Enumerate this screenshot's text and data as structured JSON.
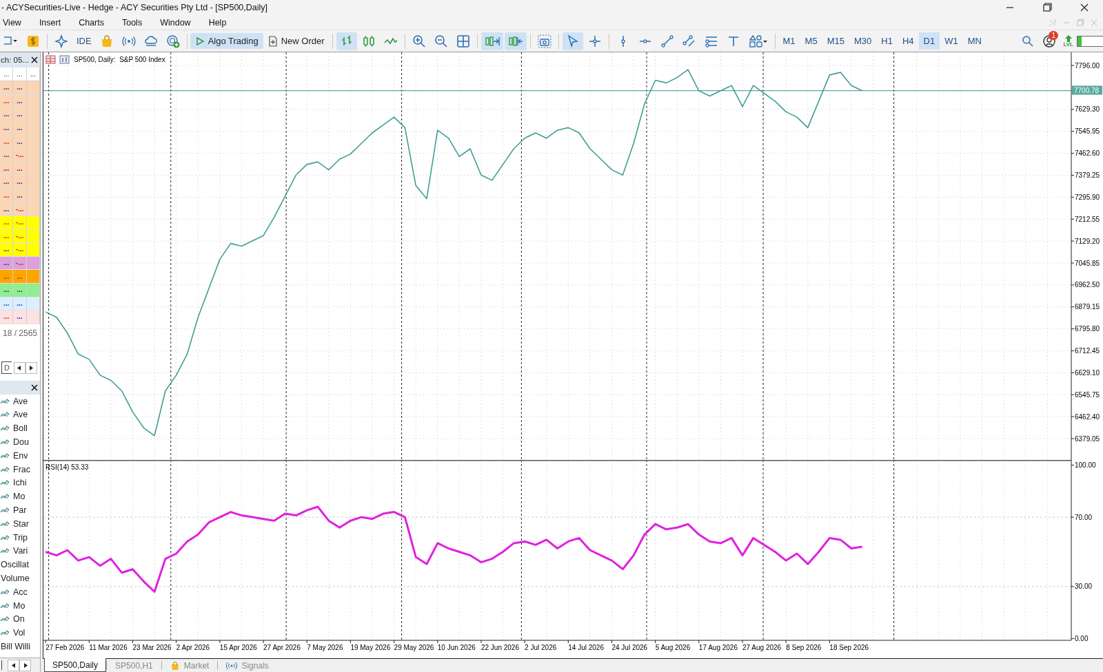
{
  "window": {
    "title": "- ACYSecurities-Live - Hedge - ACY Securities Pty Ltd - [SP500,Daily]"
  },
  "menu": [
    "View",
    "Insert",
    "Charts",
    "Tools",
    "Window",
    "Help"
  ],
  "toolbar": {
    "ide_label": "IDE",
    "algo_trading": {
      "label": "Algo Trading",
      "on": true
    },
    "new_order": "New Order",
    "chart_types": [
      {
        "selected": true
      },
      {
        "selected": false
      },
      {
        "selected": false
      }
    ],
    "auto_scroll": {
      "on": true
    },
    "chart_shift": {
      "on": true
    },
    "cursor_tools": [
      {
        "selected": true
      },
      {
        "selected": false
      }
    ],
    "timeframes": [
      {
        "label": "M1",
        "selected": false
      },
      {
        "label": "M5",
        "selected": false
      },
      {
        "label": "M15",
        "selected": false
      },
      {
        "label": "M30",
        "selected": false
      },
      {
        "label": "H1",
        "selected": false
      },
      {
        "label": "H4",
        "selected": false
      },
      {
        "label": "D1",
        "selected": true
      },
      {
        "label": "W1",
        "selected": false
      },
      {
        "label": "MN",
        "selected": false
      }
    ],
    "notifications": "1",
    "level_badge": "LVL",
    "meter": {
      "level": 0.15
    }
  },
  "market_watch": {
    "title": "ch: 05...",
    "columns": [
      "...",
      "...",
      "..."
    ],
    "rows": [
      {
        "color": "#fcd5b4",
        "bid": "...",
        "change": "...",
        "bid_down": false,
        "change_down": false
      },
      {
        "color": "#fcd5b4",
        "bid": "...",
        "change": "...",
        "bid_down": true,
        "change_down": false
      },
      {
        "color": "#fcd5b4",
        "bid": "...",
        "change": "...",
        "bid_down": false,
        "change_down": false
      },
      {
        "color": "#fcd5b4",
        "bid": "...",
        "change": "...",
        "bid_down": false,
        "change_down": false
      },
      {
        "color": "#fcd5b4",
        "bid": "...",
        "change": "...",
        "bid_down": true,
        "change_down": false
      },
      {
        "color": "#fcd5b4",
        "bid": "...",
        "change": "-...",
        "bid_down": false,
        "change_down": true
      },
      {
        "color": "#fcd5b4",
        "bid": "...",
        "change": "...",
        "bid_down": false,
        "change_down": false
      },
      {
        "color": "#fcd5b4",
        "bid": "...",
        "change": "...",
        "bid_down": false,
        "change_down": false
      },
      {
        "color": "#fcd5b4",
        "bid": "...",
        "change": "...",
        "bid_down": true,
        "change_down": false
      },
      {
        "color": "#fcd5b4",
        "bid": "...",
        "change": "-...",
        "bid_down": false,
        "change_down": true
      },
      {
        "color": "#ffff00",
        "bid": "...",
        "change": "-...",
        "bid_down": true,
        "change_down": true
      },
      {
        "color": "#ffff00",
        "bid": "...",
        "change": "-...",
        "bid_down": true,
        "change_down": true
      },
      {
        "color": "#ffff00",
        "bid": "...",
        "change": "-...",
        "bid_down": false,
        "change_down": true
      },
      {
        "color": "#dda0dd",
        "bid": "...",
        "change": "-...",
        "bid_down": false,
        "change_down": true
      },
      {
        "color": "#ffa500",
        "bid": "...",
        "change": "...",
        "bid_down": true,
        "change_down": true
      },
      {
        "color": "#90ee90",
        "bid": "...",
        "change": "...",
        "bid_down": false,
        "change_down": false
      },
      {
        "color": "#ddeeff",
        "bid": "...",
        "change": "...",
        "bid_down": false,
        "change_down": false
      },
      {
        "color": "#fde2e2",
        "bid": "...",
        "change": "...",
        "bid_down": true,
        "change_down": false
      }
    ],
    "count": "18 / 2565",
    "tab": "D"
  },
  "navigator": {
    "items": [
      {
        "label": "Ave",
        "kind": "indicator"
      },
      {
        "label": "Ave",
        "kind": "indicator"
      },
      {
        "label": "Boll",
        "kind": "indicator"
      },
      {
        "label": "Dou",
        "kind": "indicator"
      },
      {
        "label": "Env",
        "kind": "indicator"
      },
      {
        "label": "Frac",
        "kind": "indicator"
      },
      {
        "label": "Ichi",
        "kind": "indicator"
      },
      {
        "label": "Mo",
        "kind": "indicator"
      },
      {
        "label": "Par",
        "kind": "indicator"
      },
      {
        "label": "Star",
        "kind": "indicator"
      },
      {
        "label": "Trip",
        "kind": "indicator"
      },
      {
        "label": "Vari",
        "kind": "indicator"
      },
      {
        "label": "Oscillat",
        "kind": "folder"
      },
      {
        "label": "Volume",
        "kind": "folder"
      },
      {
        "label": "Acc",
        "kind": "indicator"
      },
      {
        "label": "Mo",
        "kind": "indicator"
      },
      {
        "label": "On",
        "kind": "indicator"
      },
      {
        "label": "Vol",
        "kind": "indicator"
      },
      {
        "label": "Bill Willi",
        "kind": "folder"
      }
    ]
  },
  "chart": {
    "header": "SP500, Daily:  S&P 500 Index",
    "chart_data": {
      "type": "line",
      "ylim": [
        6298,
        7846
      ],
      "grid": true,
      "ref_lines": [
        {
          "axis": "y",
          "value": 7700.78,
          "label": "7700.78",
          "color": "#5aa9a0"
        }
      ],
      "yticks": [
        {
          "value": 7796,
          "label": "7796.00"
        },
        {
          "value": 7629.3,
          "label": "7629.30"
        },
        {
          "value": 7545.95,
          "label": "7545.95"
        },
        {
          "value": 7462.6,
          "label": "7462.60"
        },
        {
          "value": 7379.25,
          "label": "7379.25"
        },
        {
          "value": 7295.9,
          "label": "7295.90"
        },
        {
          "value": 7212.55,
          "label": "7212.55"
        },
        {
          "value": 7129.2,
          "label": "7129.20"
        },
        {
          "value": 7045.85,
          "label": "7045.85"
        },
        {
          "value": 6962.5,
          "label": "6962.50"
        },
        {
          "value": 6879.15,
          "label": "6879.15"
        },
        {
          "value": 6795.8,
          "label": "6795.80"
        },
        {
          "value": 6712.45,
          "label": "6712.45"
        },
        {
          "value": 6629.1,
          "label": "6629.10"
        },
        {
          "value": 6545.75,
          "label": "6545.75"
        },
        {
          "value": 6462.4,
          "label": "6462.40"
        },
        {
          "value": 6379.05,
          "label": "6379.05"
        }
      ],
      "series": [
        {
          "color": "#3f9e93",
          "values": [
            6860,
            6840,
            6780,
            6700,
            6680,
            6620,
            6600,
            6560,
            6480,
            6420,
            6390,
            6560,
            6620,
            6700,
            6840,
            6950,
            7060,
            7120,
            7110,
            7130,
            7150,
            7220,
            7300,
            7380,
            7420,
            7430,
            7400,
            7440,
            7460,
            7500,
            7540,
            7570,
            7600,
            7560,
            7340,
            7290,
            7550,
            7520,
            7450,
            7480,
            7380,
            7360,
            7420,
            7480,
            7520,
            7540,
            7520,
            7550,
            7560,
            7540,
            7480,
            7440,
            7400,
            7380,
            7500,
            7650,
            7740,
            7730,
            7750,
            7780,
            7700,
            7680,
            7700,
            7720,
            7640,
            7720,
            7690,
            7660,
            7620,
            7600,
            7560,
            7660,
            7760,
            7770,
            7720,
            7700
          ]
        }
      ]
    }
  },
  "rsi": {
    "reading": "53.33",
    "time_axis": [
      "27 Feb 2026",
      "11 Mar 2026",
      "23 Mar 2026",
      "2 Apr 2026",
      "15 Apr 2026",
      "27 Apr 2026",
      "7 May 2026",
      "19 May 2026",
      "29 May 2026",
      "10 Jun 2026",
      "22 Jun 2026",
      "2 Jul 2026",
      "14 Jul 2026",
      "24 Jul 2026",
      "5 Aug 2026",
      "17 Aug 2026",
      "27 Aug 2026",
      "8 Sep 2026",
      "18 Sep 2026"
    ],
    "chart_data": {
      "type": "line",
      "ylim": [
        -1,
        103
      ],
      "grid": true,
      "yticks": [
        {
          "value": 100,
          "label": "100.00"
        },
        {
          "value": 70,
          "label": "70.00"
        },
        {
          "value": 30,
          "label": "30.00"
        },
        {
          "value": 0,
          "label": "0.00"
        }
      ],
      "series": [
        {
          "name": "RSI(14)",
          "color": "#e020e0",
          "values": [
            50,
            48,
            51,
            45,
            47,
            42,
            46,
            38,
            40,
            33,
            27,
            46,
            49,
            56,
            60,
            67,
            70,
            73,
            71,
            70,
            69,
            68,
            72,
            71,
            74,
            76,
            68,
            64,
            68,
            70,
            69,
            72,
            73,
            70,
            47,
            43,
            55,
            52,
            50,
            48,
            44,
            46,
            50,
            55,
            56,
            54,
            57,
            52,
            56,
            58,
            51,
            48,
            45,
            40,
            48,
            60,
            66,
            63,
            64,
            66,
            60,
            56,
            55,
            58,
            48,
            58,
            54,
            50,
            45,
            49,
            43,
            50,
            58,
            57,
            52,
            53
          ]
        }
      ]
    }
  },
  "tabs": [
    {
      "label": "SP500,Daily",
      "selected": true,
      "kind": "chart"
    },
    {
      "label": "SP500,H1",
      "selected": false,
      "kind": "chart"
    },
    {
      "label": "Market",
      "selected": false,
      "kind": "market"
    },
    {
      "label": "Signals",
      "selected": false,
      "kind": "signals"
    }
  ]
}
